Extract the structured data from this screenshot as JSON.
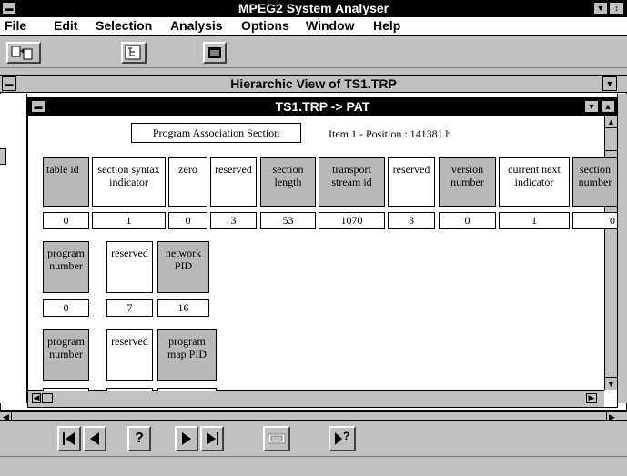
{
  "app": {
    "title": "MPEG2 System Analyser"
  },
  "menu": [
    "File",
    "Edit",
    "Selection",
    "Analysis",
    "Options",
    "Window",
    "Help"
  ],
  "mdi": {
    "title": "Hierarchic View of TS1.TRP"
  },
  "child": {
    "title": "TS1.TRP -> PAT",
    "section_label": "Program Association Section",
    "item_info": "Item 1 - Position : 141381 b"
  },
  "row1": {
    "fields": [
      "table id",
      "section syntax indicator",
      "zero",
      "reserved",
      "section length",
      "transport stream id",
      "reserved",
      "version number",
      "current next indicator",
      "section number"
    ],
    "values": [
      "0",
      "1",
      "0",
      "3",
      "53",
      "1070",
      "3",
      "0",
      "1",
      "0"
    ]
  },
  "row2": {
    "fields": [
      "program number",
      "reserved",
      "network PID"
    ],
    "values": [
      "0",
      "7",
      "16"
    ]
  },
  "row3": {
    "fields": [
      "program number",
      "reserved",
      "program map PID"
    ]
  },
  "toolbar": {
    "icons": [
      "copy-icon",
      "tree-icon",
      "window-icon"
    ]
  },
  "nav": {
    "help": "?",
    "goto": "?"
  }
}
